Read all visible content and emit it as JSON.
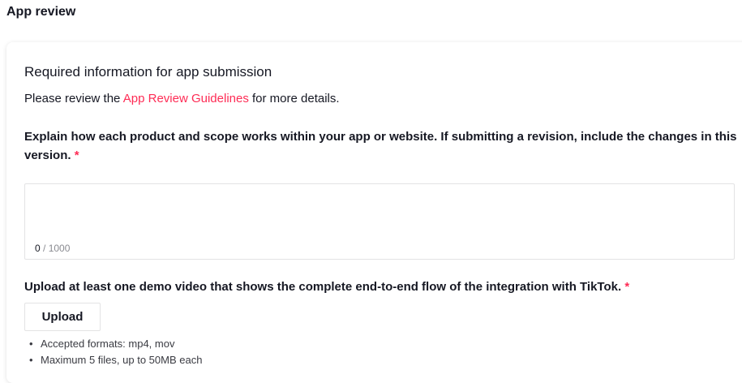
{
  "page": {
    "title": "App review"
  },
  "form": {
    "section_title": "Required information for app submission",
    "intro_prefix": "Please review the ",
    "intro_link": "App Review Guidelines",
    "intro_suffix": " for more details.",
    "question1": "Explain how each product and scope works within your app or website. If submitting a revision, include the changes in this version.",
    "required_mark": "*",
    "textarea": {
      "value": "",
      "count": "0",
      "max": "/ 1000"
    },
    "question2": "Upload at least one demo video that shows the complete end-to-end flow of the integration with TikTok.",
    "upload_label": "Upload",
    "rules": [
      "Accepted formats: mp4, mov",
      "Maximum 5 files, up to 50MB each"
    ]
  },
  "colors": {
    "accent": "#fe2c55",
    "text": "#161823",
    "muted": "#8a8b91",
    "border": "#e3e3e4"
  }
}
